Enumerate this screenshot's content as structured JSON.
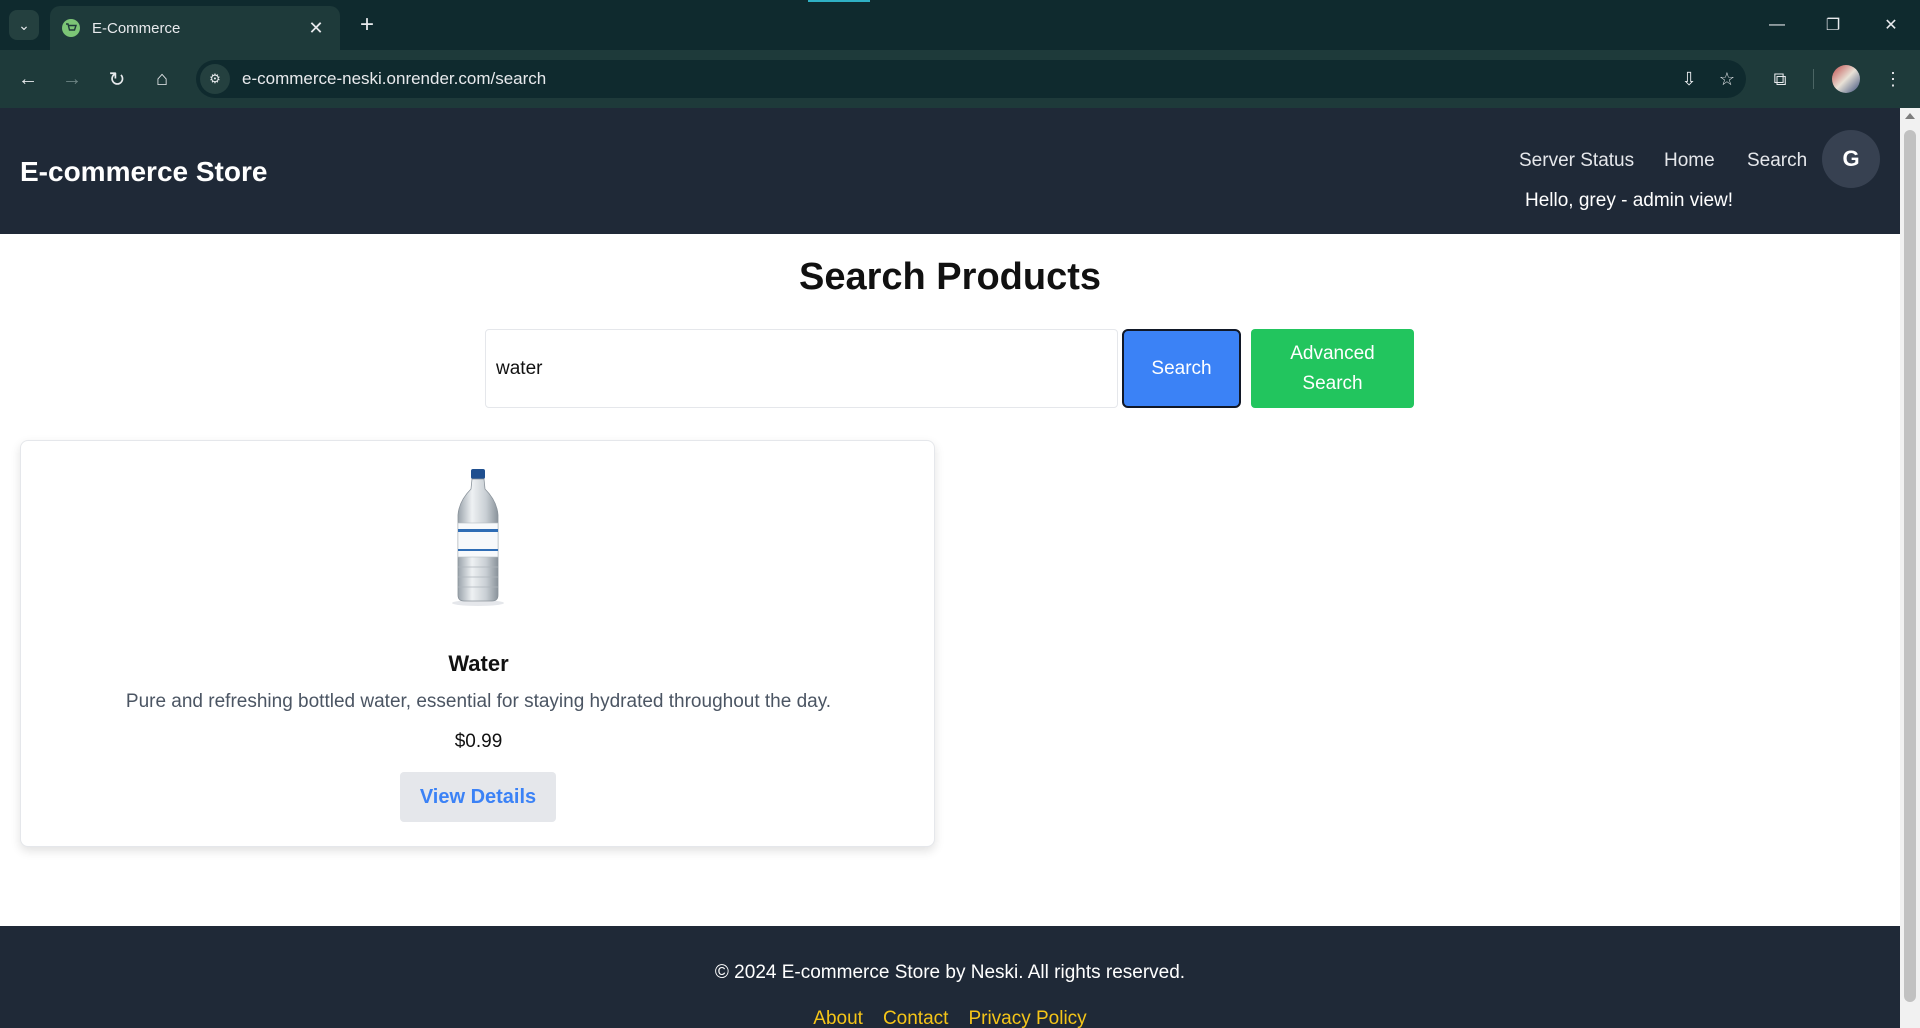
{
  "browser": {
    "tab_title": "E-Commerce",
    "url": "e-commerce-neski.onrender.com/search",
    "icons": {
      "tab_search": "chevron-down-icon",
      "new_tab": "plus-icon",
      "back": "back-arrow-icon",
      "forward": "forward-arrow-icon",
      "reload": "reload-icon",
      "home": "home-icon",
      "site_info": "tune-icon",
      "install": "install-app-icon",
      "bookmark": "star-icon",
      "extensions": "puzzle-icon",
      "menu": "kebab-menu-icon"
    }
  },
  "header": {
    "brand": "E-commerce Store",
    "nav": [
      "Server Status",
      "Home",
      "Search"
    ],
    "avatar_initial": "G",
    "greeting": "Hello, grey - admin view!"
  },
  "main": {
    "title": "Search Products",
    "search_value": "water",
    "search_button": "Search",
    "advanced_search_button": "Advanced Search"
  },
  "results": [
    {
      "name": "Water",
      "description": "Pure and refreshing bottled water, essential for staying hydrated throughout the day.",
      "price": "$0.99",
      "action": "View Details"
    }
  ],
  "footer": {
    "copyright": "© 2024 E-commerce Store by Neski. All rights reserved.",
    "links": [
      "About",
      "Contact",
      "Privacy Policy"
    ]
  },
  "colors": {
    "header_bg": "#1f2937",
    "search_button": "#3b82f6",
    "advanced_button": "#22c55e",
    "footer_link": "#f5c518"
  }
}
